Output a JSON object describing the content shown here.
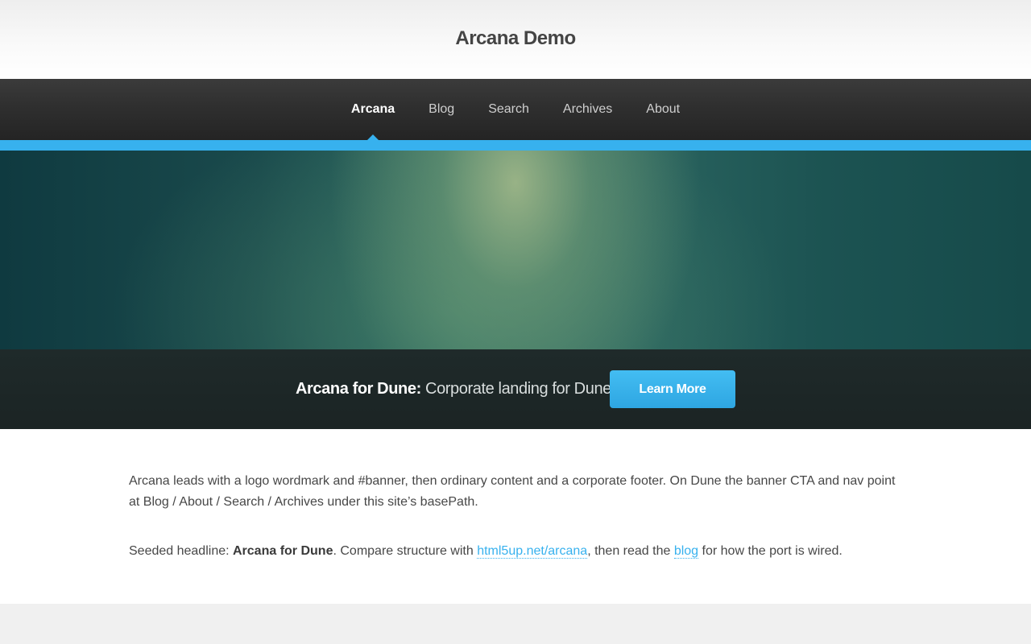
{
  "header": {
    "logo": "Arcana Demo"
  },
  "nav": {
    "items": [
      {
        "label": "Arcana",
        "current": true
      },
      {
        "label": "Blog"
      },
      {
        "label": "Search"
      },
      {
        "label": "Archives"
      },
      {
        "label": "About"
      }
    ]
  },
  "cta": {
    "title": "Arcana for Dune:",
    "subtitle": "Corporate landing for Dune",
    "button_label": "Learn More"
  },
  "content": {
    "p1": "Arcana leads with a logo wordmark and #banner, then ordinary content and a corporate footer. On Dune the banner CTA and nav point at Blog / About / Search / Archives under this site’s basePath.",
    "p2_prefix": "Seeded headline: ",
    "p2_bold": "Arcana for Dune",
    "p2_mid": ". Compare structure with ",
    "p2_link1": "html5up.net/arcana",
    "p2_mid2": ", then read the ",
    "p2_link2": "blog",
    "p2_suffix": " for how the port is wired."
  },
  "colors": {
    "accent": "#37b1ee",
    "nav_bg": "#2f2f2f",
    "cta_bg": "#1f2a2a"
  }
}
